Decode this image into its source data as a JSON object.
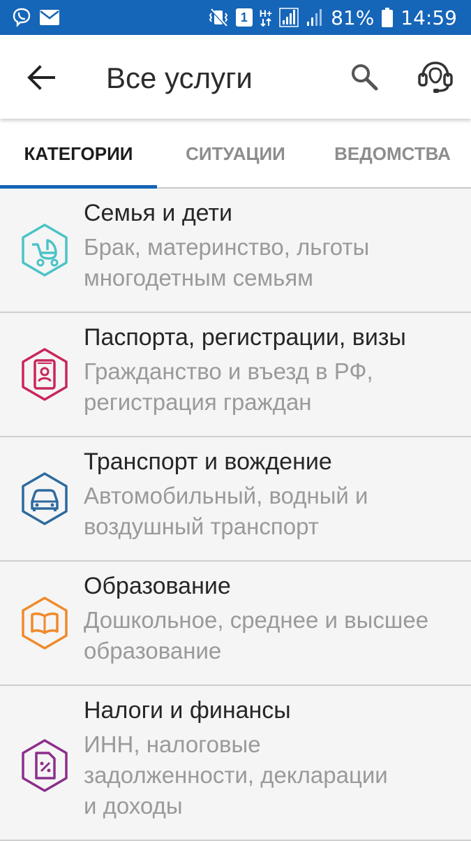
{
  "status_bar": {
    "battery_percent": "81%",
    "time": "14:59",
    "sim_slot": "1",
    "network_type": "H+",
    "icons": [
      "viber-icon",
      "mail-icon",
      "vibrate-icon",
      "sim-icon",
      "network-icon",
      "signal-icon",
      "signal-2-icon",
      "battery-icon"
    ]
  },
  "app_bar": {
    "title": "Все услуги",
    "icons": [
      "back-arrow-icon",
      "search-icon",
      "support-headset-icon"
    ]
  },
  "tabs": [
    {
      "label": "КАТЕГОРИИ",
      "active": true
    },
    {
      "label": "СИТУАЦИИ",
      "active": false
    },
    {
      "label": "ВЕДОМСТВА",
      "active": false
    }
  ],
  "categories": [
    {
      "title": "Семья и дети",
      "desc_line1": "Брак, материнство, льготы",
      "desc_line2": "многодетным семьям",
      "desc_line3": "",
      "icon": "baby-stroller-icon",
      "color": "#4cc3c7"
    },
    {
      "title": "Паспорта, регистрации, визы",
      "desc_line1": "Гражданство и въезд в РФ,",
      "desc_line2": "регистрация граждан",
      "desc_line3": "",
      "icon": "passport-icon",
      "color": "#c9265a"
    },
    {
      "title": "Транспорт и вождение",
      "desc_line1": "Автомобильный, водный и",
      "desc_line2": "воздушный транспорт",
      "desc_line3": "",
      "icon": "car-icon",
      "color": "#2d6a9e"
    },
    {
      "title": "Образование",
      "desc_line1": "Дошкольное, среднее и высшее",
      "desc_line2": "образование",
      "desc_line3": "",
      "icon": "book-icon",
      "color": "#f08a2a"
    },
    {
      "title": "Налоги и финансы",
      "desc_line1": "ИНН, налоговые",
      "desc_line2": "задолженности, декларации",
      "desc_line3": "и доходы",
      "icon": "tax-document-icon",
      "color": "#8b2f8b"
    }
  ]
}
